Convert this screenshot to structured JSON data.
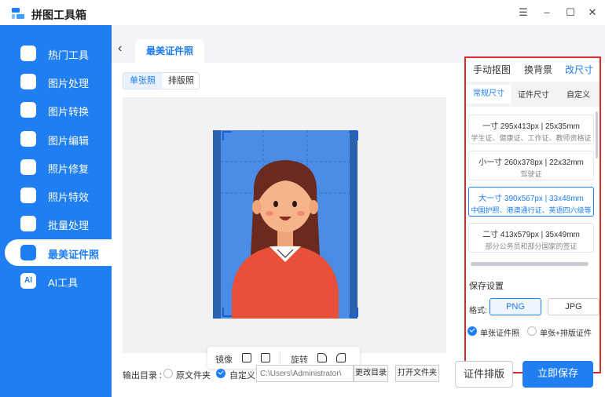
{
  "app": {
    "title": "拼图工具箱"
  },
  "colors": {
    "accent": "#1e7ef2",
    "highlight_border": "#d52b2b"
  },
  "window_controls": {
    "menu": "☰",
    "minimize": "–",
    "maximize": "☐",
    "close": "✕"
  },
  "sidebar": {
    "items": [
      {
        "label": "热门工具",
        "icon": "hot-tools-icon"
      },
      {
        "label": "图片处理",
        "icon": "image-process-icon"
      },
      {
        "label": "图片转换",
        "icon": "image-convert-icon"
      },
      {
        "label": "图片编辑",
        "icon": "image-edit-icon"
      },
      {
        "label": "照片修复",
        "icon": "photo-repair-icon"
      },
      {
        "label": "照片特效",
        "icon": "photo-effect-icon"
      },
      {
        "label": "批量处理",
        "icon": "batch-process-icon"
      },
      {
        "label": "最美证件照",
        "icon": "id-photo-icon",
        "active": true
      },
      {
        "label": "AI工具",
        "icon": "ai-tools-icon"
      }
    ],
    "ai_badge": "AI"
  },
  "header": {
    "back_icon": "‹",
    "page_tab": "最美证件照"
  },
  "mode": {
    "single": "单张照",
    "layout": "排版照"
  },
  "toolbar": {
    "mirror": "镜像",
    "rotate": "旋转"
  },
  "output": {
    "label": "输出目录 :",
    "original_folder": "原文件夹",
    "custom": "自定义",
    "path_placeholder": "C:\\Users\\Administrator\\",
    "change_dir": "更改目录",
    "open_folder": "打开文件夹"
  },
  "panel": {
    "tabs": [
      "手动抠图",
      "换背景",
      "改尺寸"
    ],
    "active_tab": "改尺寸",
    "subtabs": [
      "常规尺寸",
      "证件尺寸",
      "自定义"
    ],
    "sizes": [
      {
        "size": "一寸 295x413px | 25x35mm",
        "desc": "学生证、健康证、工作证、教师资格证"
      },
      {
        "size": "小一寸 260x378px | 22x32mm",
        "desc": "驾驶证"
      },
      {
        "size": "大一寸 390x567px | 33x48mm",
        "desc": "中国护照、港澳通行证、英语四六级等",
        "active": true
      },
      {
        "size": "二寸 413x579px | 35x49mm",
        "desc": "部分公务员和部分国家的签证"
      }
    ],
    "save_settings": "保存设置",
    "format_label": "格式:",
    "formats": [
      "PNG",
      "JPG"
    ],
    "selected_format": "PNG",
    "save_single": "单张证件照",
    "save_single_layout": "单张+排版证件"
  },
  "actions": {
    "layout_button": "证件排版",
    "save_button": "立即保存"
  }
}
